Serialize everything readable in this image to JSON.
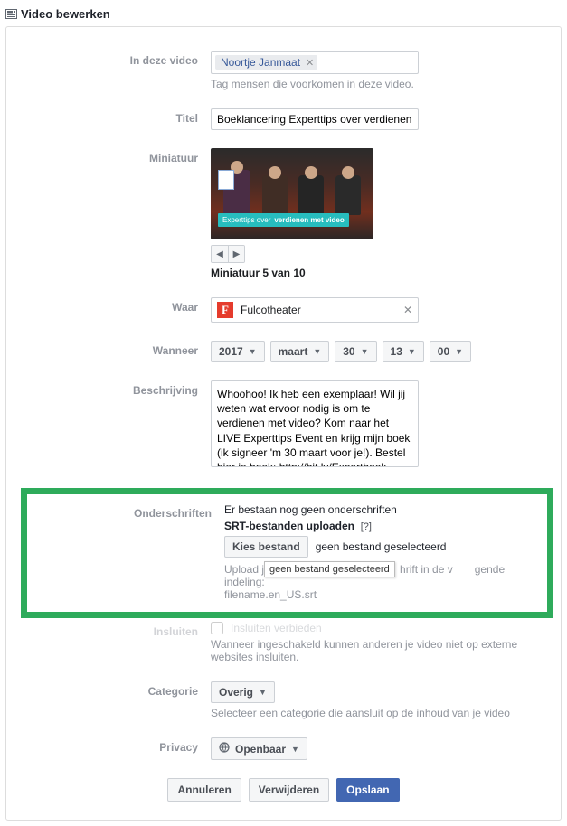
{
  "header": {
    "title": "Video bewerken"
  },
  "tags": {
    "label": "In deze video",
    "people": [
      "Noortje Janmaat"
    ],
    "help": "Tag mensen die voorkomen in deze video."
  },
  "title_row": {
    "label": "Titel",
    "value": "Boeklancering Experttips over verdienen met"
  },
  "thumb": {
    "label": "Miniatuur",
    "banner_1": "Experttips over",
    "banner_2": "verdienen met video",
    "caption": "Miniatuur 5 van 10"
  },
  "where": {
    "label": "Waar",
    "place": "Fulcotheater"
  },
  "when": {
    "label": "Wanneer",
    "year": "2017",
    "month": "maart",
    "day": "30",
    "hour": "13",
    "minute": "00"
  },
  "desc": {
    "label": "Beschrijving",
    "text": "Whoohoo! Ik heb een exemplaar! Wil jij weten wat ervoor nodig is om te verdienen met video? Kom naar het LIVE Experttips Event en krijg mijn boek (ik signeer 'm 30 maart voor je!). Bestel hier je boek: http://bit.ly/Expertboek"
  },
  "captions": {
    "label": "Onderschriften",
    "none": "Er bestaan nog geen onderschriften",
    "upload_prefix": "SRT-bestanden uploaden",
    "help_mark": "[?]",
    "choose": "Kies bestand",
    "nofile": "geen bestand geselecteerd",
    "tooltip": "geen bestand geselecteerd",
    "note_pre": "Upload je",
    "note_mid": "hrift in de v",
    "note_post": "gende indeling:",
    "note_full_1": "Upload je",
    "note_full_2": "gende indeling:",
    "format": "filename.en_US.srt"
  },
  "embed": {
    "label": "Insluiten",
    "cb_label": "Insluiten verbieden",
    "help": "Wanneer ingeschakeld kunnen anderen je video niet op externe websites insluiten."
  },
  "category": {
    "label": "Categorie",
    "value": "Overig",
    "help": "Selecteer een categorie die aansluit op de inhoud van je video"
  },
  "privacy": {
    "label": "Privacy",
    "value": "Openbaar"
  },
  "footer": {
    "cancel": "Annuleren",
    "delete": "Verwijderen",
    "save": "Opslaan"
  }
}
